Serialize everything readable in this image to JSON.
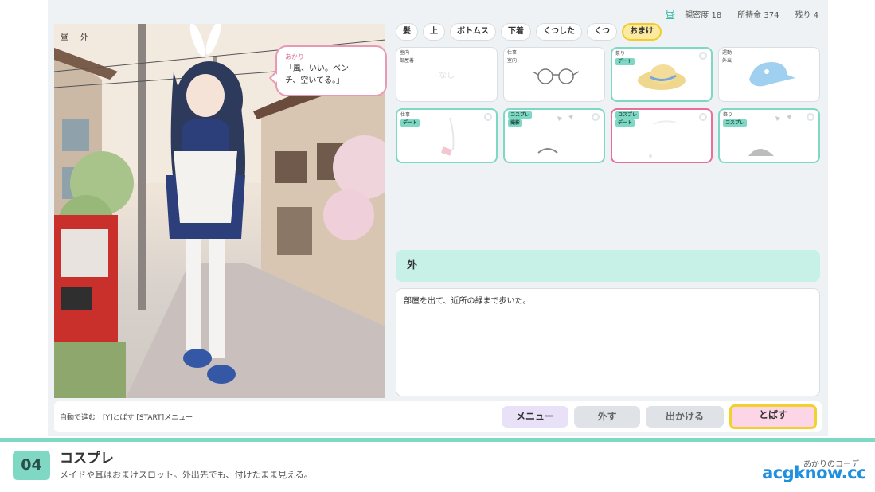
{
  "scene": {
    "title": "昼 外"
  },
  "status": {
    "time_icon": "昼",
    "affinity": "親密度 18",
    "money": "所持金 374",
    "remaining": "残り 4"
  },
  "speech": {
    "speaker": "あかり",
    "line1": "「風、いい。ベン",
    "line2": "チ、空いてる。」"
  },
  "tabs": [
    {
      "label": "髪"
    },
    {
      "label": "上"
    },
    {
      "label": "ボトムス"
    },
    {
      "label": "下着"
    },
    {
      "label": "くつした"
    },
    {
      "label": "くつ"
    },
    {
      "label": "おまけ",
      "active": true
    }
  ],
  "items": [
    {
      "tags": [
        "室内",
        "部屋着"
      ],
      "empty": "なし"
    },
    {
      "tags": [
        "仕事",
        "室内"
      ],
      "item_icon": "glasses-icon"
    },
    {
      "tags": [
        "祭り",
        "デート"
      ],
      "item_icon": "straw-hat-icon",
      "selected": true
    },
    {
      "tags": [
        "運動",
        "外出"
      ],
      "item_icon": "cap-icon"
    },
    {
      "tags": [
        "仕事",
        "デート"
      ],
      "item_icon": "necktie-icon",
      "selected": true
    },
    {
      "tags": [
        "コスプレ",
        "撮影"
      ],
      "item_icon": "choker-icon",
      "selected": true
    },
    {
      "tags": [
        "コスプレ",
        "デート"
      ],
      "item_icon": "bunny-ears-icon",
      "equipped": true
    },
    {
      "tags": [
        "祭り",
        "コスプレ"
      ],
      "item_icon": "fan-icon",
      "selected": true
    }
  ],
  "location": "外",
  "description": "部屋を出て、近所の緑まで歩いた。",
  "hint": "自動で進む　[Y]とばす [START]メニュー",
  "buttons": {
    "menu": "メニュー",
    "remove": "外す",
    "outing": "出かける",
    "skip": "とばす"
  },
  "caption": {
    "number": "04",
    "title": "コスプレ",
    "subtitle": "メイドや耳はおまけスロット。外出先でも、付けたまま見える。",
    "right": "あかりのコーデ"
  },
  "watermark": "acgknow.cc",
  "colors": {
    "accent": "#7fd8c3",
    "active_tab": "#f2cc2a",
    "equipped_border": "#e86f98",
    "skip_button": "#fcd6e6",
    "menu_button": "#e8e1f7"
  }
}
